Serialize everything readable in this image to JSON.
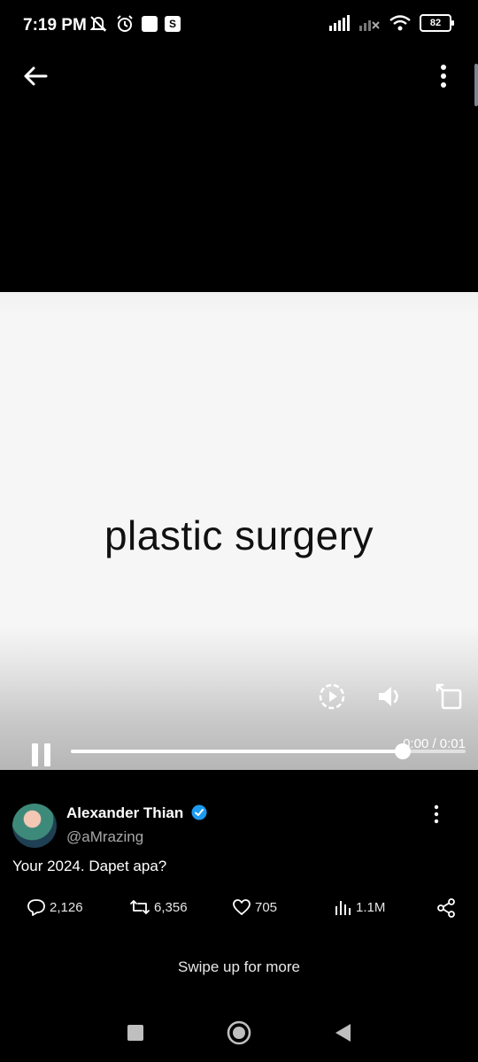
{
  "status_bar": {
    "time": "7:19 PM",
    "battery": "82",
    "icons": [
      "mute-icon",
      "alarm-icon",
      "notification-square-icon",
      "s-app-icon",
      "signal-icon",
      "signal-weak-icon",
      "wifi-icon",
      "battery-icon"
    ]
  },
  "video": {
    "caption": "plastic surgery",
    "time_readout": "0:00 / 0:01",
    "progress": 0.84,
    "controls": [
      "replay-icon",
      "volume-icon",
      "rotate-icon",
      "pause-icon"
    ]
  },
  "post": {
    "author_name": "Alexander Thian",
    "author_handle": "@aMrazing",
    "text": "Your 2024. Dapet apa?",
    "replies": "2,126",
    "reposts": "6,356",
    "likes": "705",
    "views": "1.1M"
  },
  "footer": {
    "swipe_hint": "Swipe up for more"
  },
  "colors": {
    "background": "#000000",
    "verified": "#1d9bf0",
    "handle": "#a8a8a8"
  }
}
